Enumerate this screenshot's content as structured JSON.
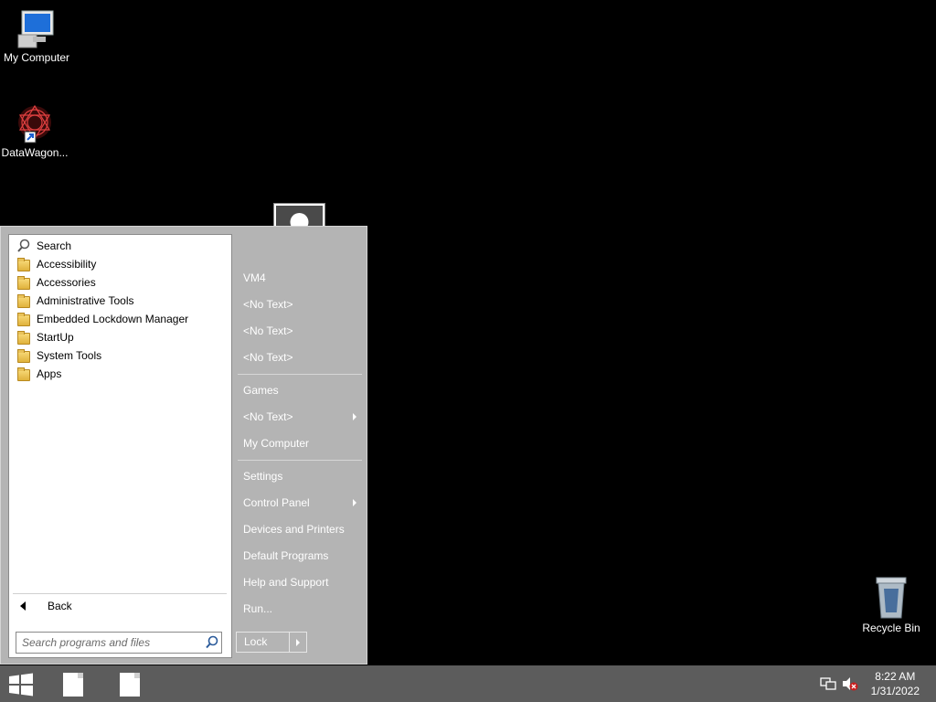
{
  "desktop": {
    "icons": [
      {
        "label": "My Computer"
      },
      {
        "label": "DataWagon..."
      },
      {
        "label": "Recycle Bin"
      }
    ]
  },
  "start_menu": {
    "programs": [
      {
        "label": "Search",
        "icon": "magnifier-icon"
      },
      {
        "label": "Accessibility",
        "icon": "folder-icon"
      },
      {
        "label": "Accessories",
        "icon": "folder-icon"
      },
      {
        "label": "Administrative Tools",
        "icon": "folder-icon"
      },
      {
        "label": "Embedded Lockdown Manager",
        "icon": "folder-icon"
      },
      {
        "label": "StartUp",
        "icon": "folder-icon"
      },
      {
        "label": "System Tools",
        "icon": "folder-icon"
      },
      {
        "label": "Apps",
        "icon": "apps-folder-icon"
      }
    ],
    "back_label": "Back",
    "search_placeholder": "Search programs and files",
    "right_items": [
      {
        "label": "VM4"
      },
      {
        "label": "<No Text>"
      },
      {
        "label": "<No Text>"
      },
      {
        "label": "<No Text>"
      },
      {
        "label": "Games"
      },
      {
        "label": "<No Text>",
        "has_submenu": true
      },
      {
        "label": "My Computer"
      },
      {
        "label": "Settings"
      },
      {
        "label": "Control Panel",
        "has_submenu": true
      },
      {
        "label": "Devices and Printers"
      },
      {
        "label": "Default Programs"
      },
      {
        "label": "Help and Support"
      },
      {
        "label": "Run..."
      }
    ],
    "lock_label": "Lock"
  },
  "taskbar": {
    "time": "8:22 AM",
    "date": "1/31/2022"
  },
  "colors": {
    "menu_bg": "#b4b4b4",
    "taskbar_bg": "#5c5c5c",
    "desktop_bg": "#000000"
  }
}
